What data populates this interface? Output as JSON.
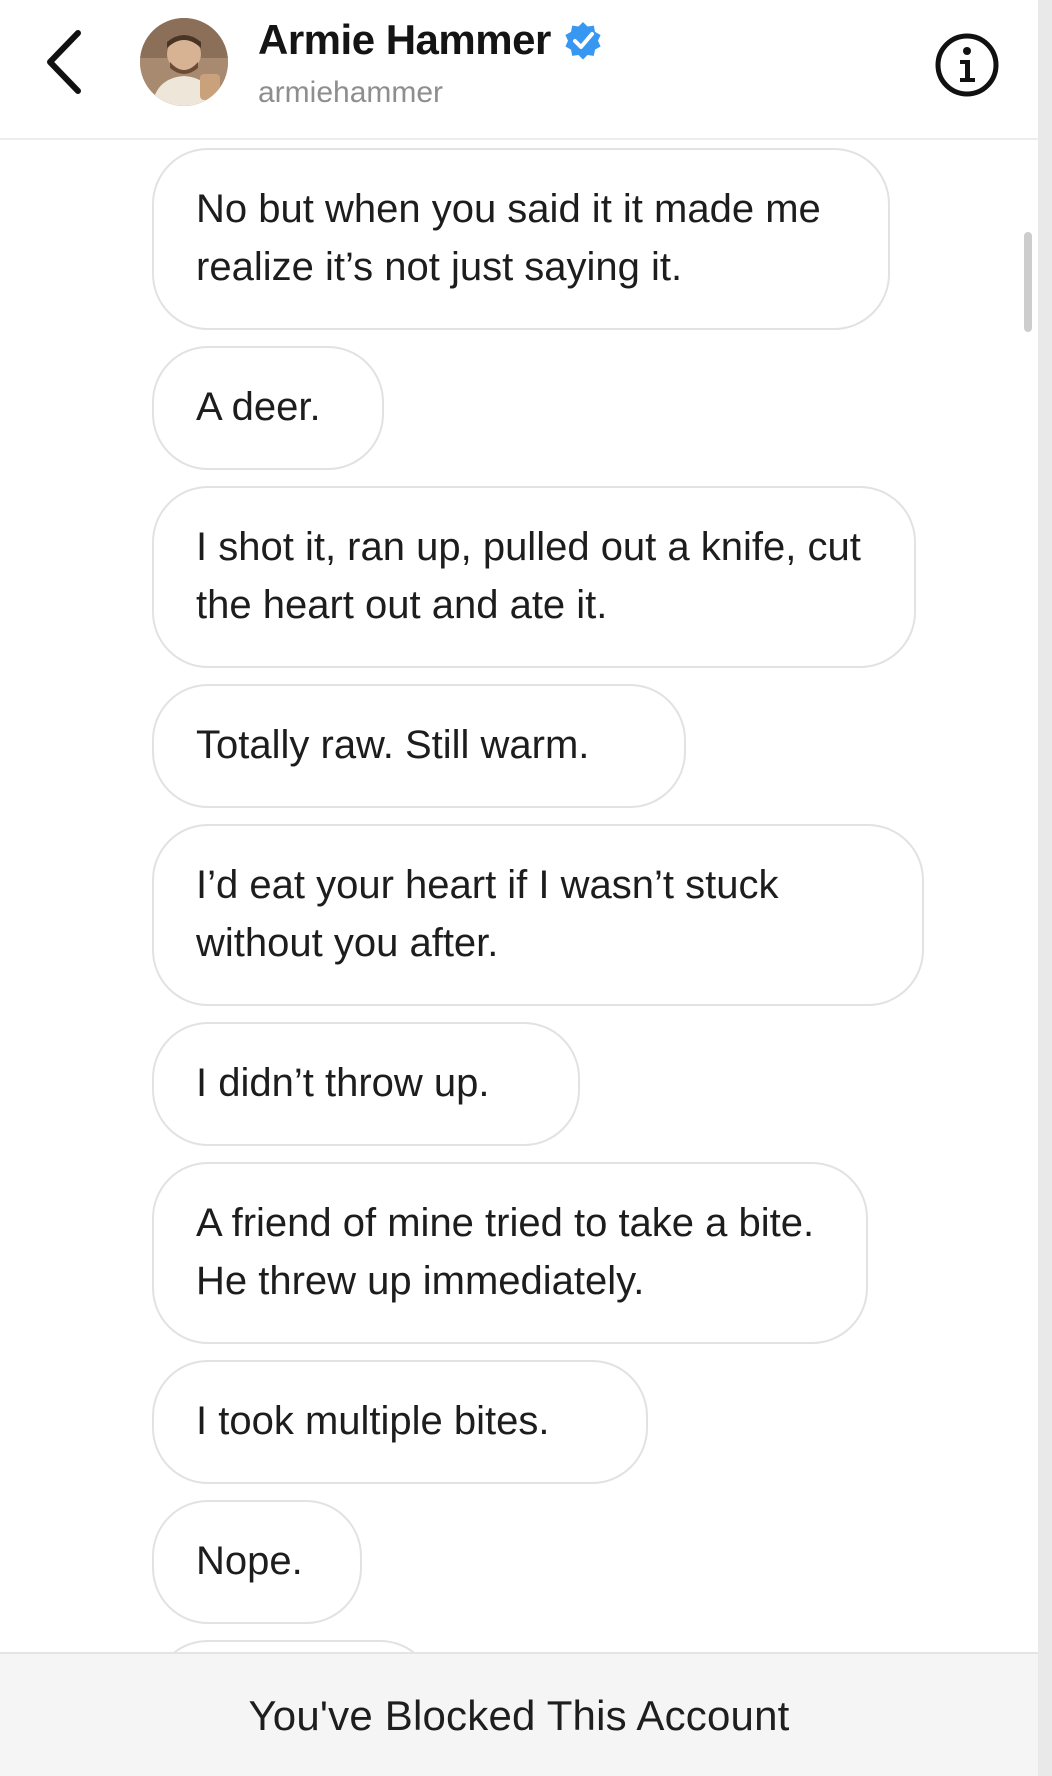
{
  "header": {
    "name": "Armie Hammer",
    "handle": "armiehammer",
    "icons": {
      "back": "chevron-left-icon",
      "verified": "verified-badge-icon",
      "info": "info-icon"
    },
    "verified_color": "#3897f0"
  },
  "messages": [
    {
      "text": "No but when you said it it made me realize it’s not just saying it."
    },
    {
      "text": "A deer."
    },
    {
      "text": "I shot it, ran up, pulled out a knife, cut the heart out and ate it."
    },
    {
      "text": "Totally raw. Still warm."
    },
    {
      "text": "I’d eat your heart if I wasn’t stuck without you after."
    },
    {
      "text": "I didn’t throw up."
    },
    {
      "text": "A friend of mine tried to take a bite. He threw up immediately."
    },
    {
      "text": "I took multiple bites."
    },
    {
      "text": "Nope."
    }
  ],
  "footer": {
    "text": "You've Blocked This Account"
  }
}
